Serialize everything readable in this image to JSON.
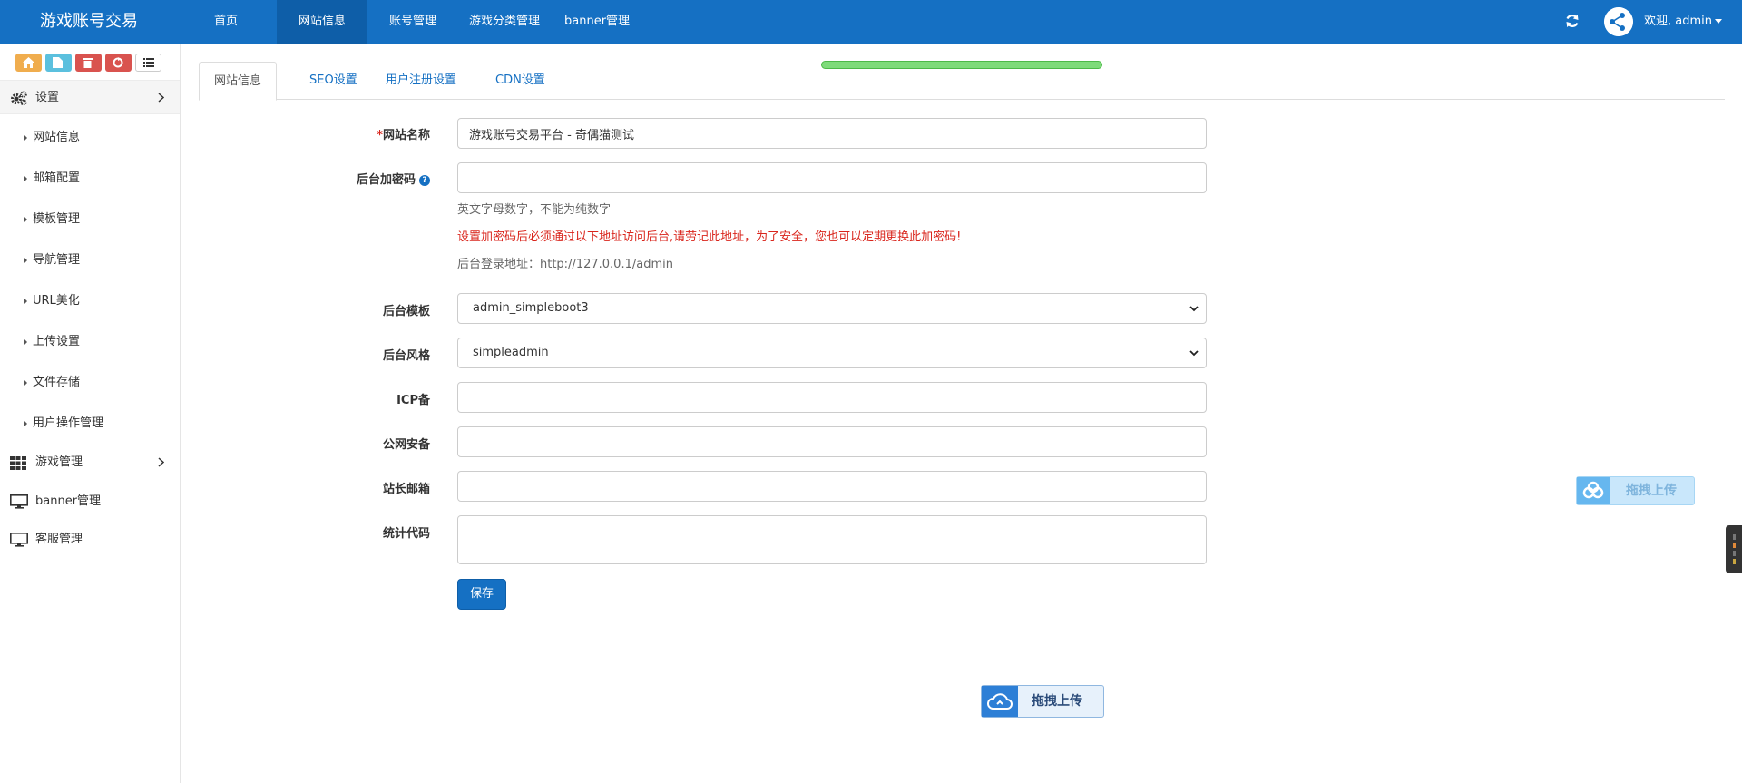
{
  "navbar": {
    "brand": "游戏账号交易",
    "items": [
      {
        "label": "首页"
      },
      {
        "label": "网站信息",
        "active": true
      },
      {
        "label": "账号管理"
      },
      {
        "label": "游戏分类管理"
      },
      {
        "label": "banner管理"
      }
    ],
    "welcome": "欢迎, admin",
    "accent_color": "#1570c3"
  },
  "shortcuts": [
    {
      "icon": "home-icon",
      "color": "#f0ad4e"
    },
    {
      "icon": "file-icon",
      "color": "#5bc0de"
    },
    {
      "icon": "trash-icon",
      "color": "#d9534f"
    },
    {
      "icon": "recycle-icon",
      "color": "#d9534f"
    },
    {
      "icon": "list-icon",
      "color": "#ffffff"
    }
  ],
  "sidebar": {
    "settings": {
      "label": "设置",
      "icon": "cogs-icon"
    },
    "sub_items": [
      {
        "label": "网站信息"
      },
      {
        "label": "邮箱配置"
      },
      {
        "label": "模板管理"
      },
      {
        "label": "导航管理"
      },
      {
        "label": "URL美化"
      },
      {
        "label": "上传设置"
      },
      {
        "label": "文件存储"
      },
      {
        "label": "用户操作管理"
      }
    ],
    "game": {
      "label": "游戏管理",
      "icon": "grid-icon"
    },
    "banner": {
      "label": "banner管理",
      "icon": "monitor-icon"
    },
    "service": {
      "label": "客服管理",
      "icon": "monitor-icon"
    }
  },
  "tabs": [
    {
      "label": "网站信息",
      "active": true
    },
    {
      "label": "SEO设置"
    },
    {
      "label": "用户注册设置"
    },
    {
      "label": "CDN设置"
    }
  ],
  "form": {
    "site_name": {
      "required_mark": "*",
      "label": "网站名称",
      "value": "游戏账号交易平台 - 奇偶猫测试"
    },
    "admin_code": {
      "label": "后台加密码",
      "value": "",
      "help_icon": "question-icon"
    },
    "help_line1": "英文字母数字，不能为纯数字",
    "help_warning": "设置加密码后必须通过以下地址访问后台,请劳记此地址，为了安全，您也可以定期更换此加密码!",
    "help_login_url": "后台登录地址：http://127.0.0.1/admin",
    "admin_template": {
      "label": "后台模板",
      "value": "admin_simpleboot3"
    },
    "admin_style": {
      "label": "后台风格",
      "value": "simpleadmin"
    },
    "icp": {
      "label": "ICP备",
      "value": ""
    },
    "police": {
      "label": "公网安备",
      "value": ""
    },
    "email": {
      "label": "站长邮箱",
      "value": ""
    },
    "stats": {
      "label": "统计代码",
      "value": ""
    },
    "save_label": "保存"
  },
  "upload_widget": {
    "label": "拖拽上传"
  }
}
